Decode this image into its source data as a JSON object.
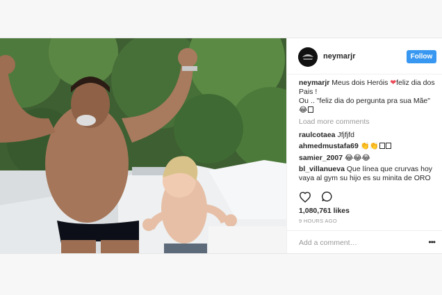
{
  "post": {
    "username": "neymarjr",
    "follow_label": "Follow",
    "caption": {
      "user": "neymarjr",
      "text_1": "Meus dois Heróis",
      "text_2": "feliz dia dos Pais !",
      "text_3": "Ou .. \"feliz dia do pergunta pra sua Mãe\""
    },
    "load_more": "Load more comments",
    "comments": [
      {
        "user": "raulcotaea",
        "text": "Jfjfjfd"
      },
      {
        "user": "ahmedmustafa69",
        "text": "👏👏"
      },
      {
        "user": "samier_2007",
        "text": "😂😂😂"
      },
      {
        "user": "bl_villanueva",
        "text": "Que línea que crurvas hoy vaya al gym su hijo es su minita de ORO"
      }
    ],
    "likes": "1,080,761 likes",
    "time": "9 HOURS AGO",
    "add_comment_placeholder": "Add a comment…",
    "more_label": "•••"
  },
  "icons": {
    "like": "heart-outline-icon",
    "comment": "comment-bubble-icon",
    "avatar": "profile-avatar-icon",
    "more": "more-options-icon"
  },
  "colors": {
    "accent": "#3897f0",
    "heart": "#ed4956"
  }
}
